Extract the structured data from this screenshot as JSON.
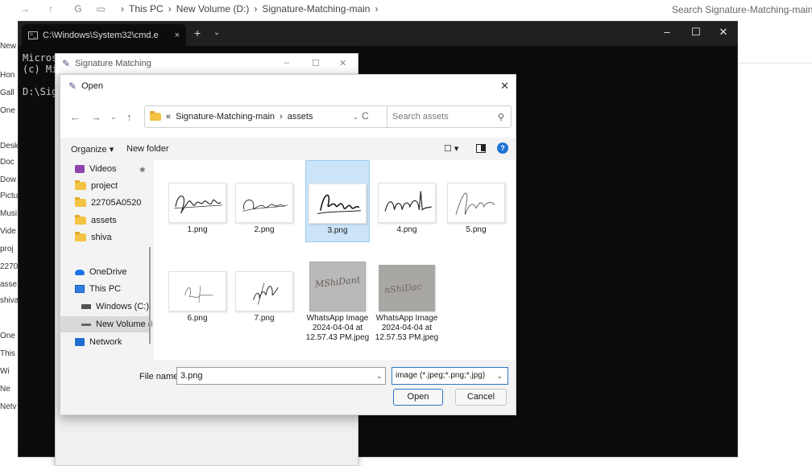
{
  "explorer": {
    "breadcrumbs": [
      "This PC",
      "New Volume (D:)",
      "Signature-Matching-main"
    ],
    "search_placeholder": "Search Signature-Matching-main",
    "sidebar_fragments": [
      "New",
      "Hon",
      "Gall",
      "One",
      "Desk",
      "Doc",
      "Dow",
      "Pictu",
      "Musi",
      "Vide",
      "proj",
      "2270",
      "asse",
      "shiva",
      "One",
      "This",
      "Wi",
      "Ne",
      "Netv"
    ]
  },
  "terminal": {
    "tab_title": "C:\\Windows\\System32\\cmd.e",
    "tab_close": "×",
    "new_tab": "+",
    "dropdown": "⌄",
    "minimize": "–",
    "maximize": "☐",
    "close": "✕",
    "lines": [
      "Micros",
      "(c) Mi",
      "",
      "D:\\Sig"
    ]
  },
  "app_window": {
    "title": "Signature Matching",
    "minimize": "–",
    "maximize": "☐",
    "close": "✕"
  },
  "open_dialog": {
    "title": "Open",
    "close": "✕",
    "nav": {
      "back": "←",
      "forward": "→",
      "recent": "⌄",
      "up": "↑"
    },
    "address": {
      "overflow": "«",
      "crumbs": [
        "Signature-Matching-main",
        "›",
        "assets"
      ],
      "chevron": "⌄",
      "refresh": "C"
    },
    "search_placeholder": "Search assets",
    "search_icon": "⚲",
    "toolbar": {
      "organize": "Organize ▾",
      "new_folder": "New folder",
      "view": "☐ ▾",
      "help": "?"
    },
    "nav_pane": [
      {
        "label": "Videos",
        "icon": "videos-icon"
      },
      {
        "label": "project",
        "icon": "folder-icon"
      },
      {
        "label": "22705A0520",
        "icon": "folder-icon"
      },
      {
        "label": "assets",
        "icon": "folder-icon"
      },
      {
        "label": "shiva",
        "icon": "folder-icon"
      },
      {
        "label": "OneDrive",
        "icon": "onedrive-icon"
      },
      {
        "label": "This PC",
        "icon": "this-pc-icon"
      },
      {
        "label": "Windows (C:)",
        "icon": "drive-icon"
      },
      {
        "label": "New Volume (D:",
        "icon": "drive-icon"
      },
      {
        "label": "Network",
        "icon": "network-icon"
      }
    ],
    "pin": "✱",
    "files": [
      {
        "name": "1.png",
        "kind": "signature"
      },
      {
        "name": "2.png",
        "kind": "signature"
      },
      {
        "name": "3.png",
        "kind": "signature"
      },
      {
        "name": "4.png",
        "kind": "signature"
      },
      {
        "name": "5.png",
        "kind": "signature"
      },
      {
        "name": "6.png",
        "kind": "signature"
      },
      {
        "name": "7.png",
        "kind": "signature"
      },
      {
        "name": "WhatsApp Image 2024-04-04 at 12.57.43 PM.jpeg",
        "kind": "photo",
        "photo_text": "MShiDant"
      },
      {
        "name": "WhatsApp Image 2024-04-04 at 12.57.53 PM.jpeg",
        "kind": "photo",
        "photo_text": "nShiDac"
      }
    ],
    "file_name_label": "File name:",
    "file_name_value": "3.png",
    "file_name_chevron": "⌄",
    "file_type": "image (*.jpeg;*.png;*.jpg)",
    "file_type_chevron": "⌄",
    "open_label": "Open",
    "cancel_label": "Cancel"
  }
}
